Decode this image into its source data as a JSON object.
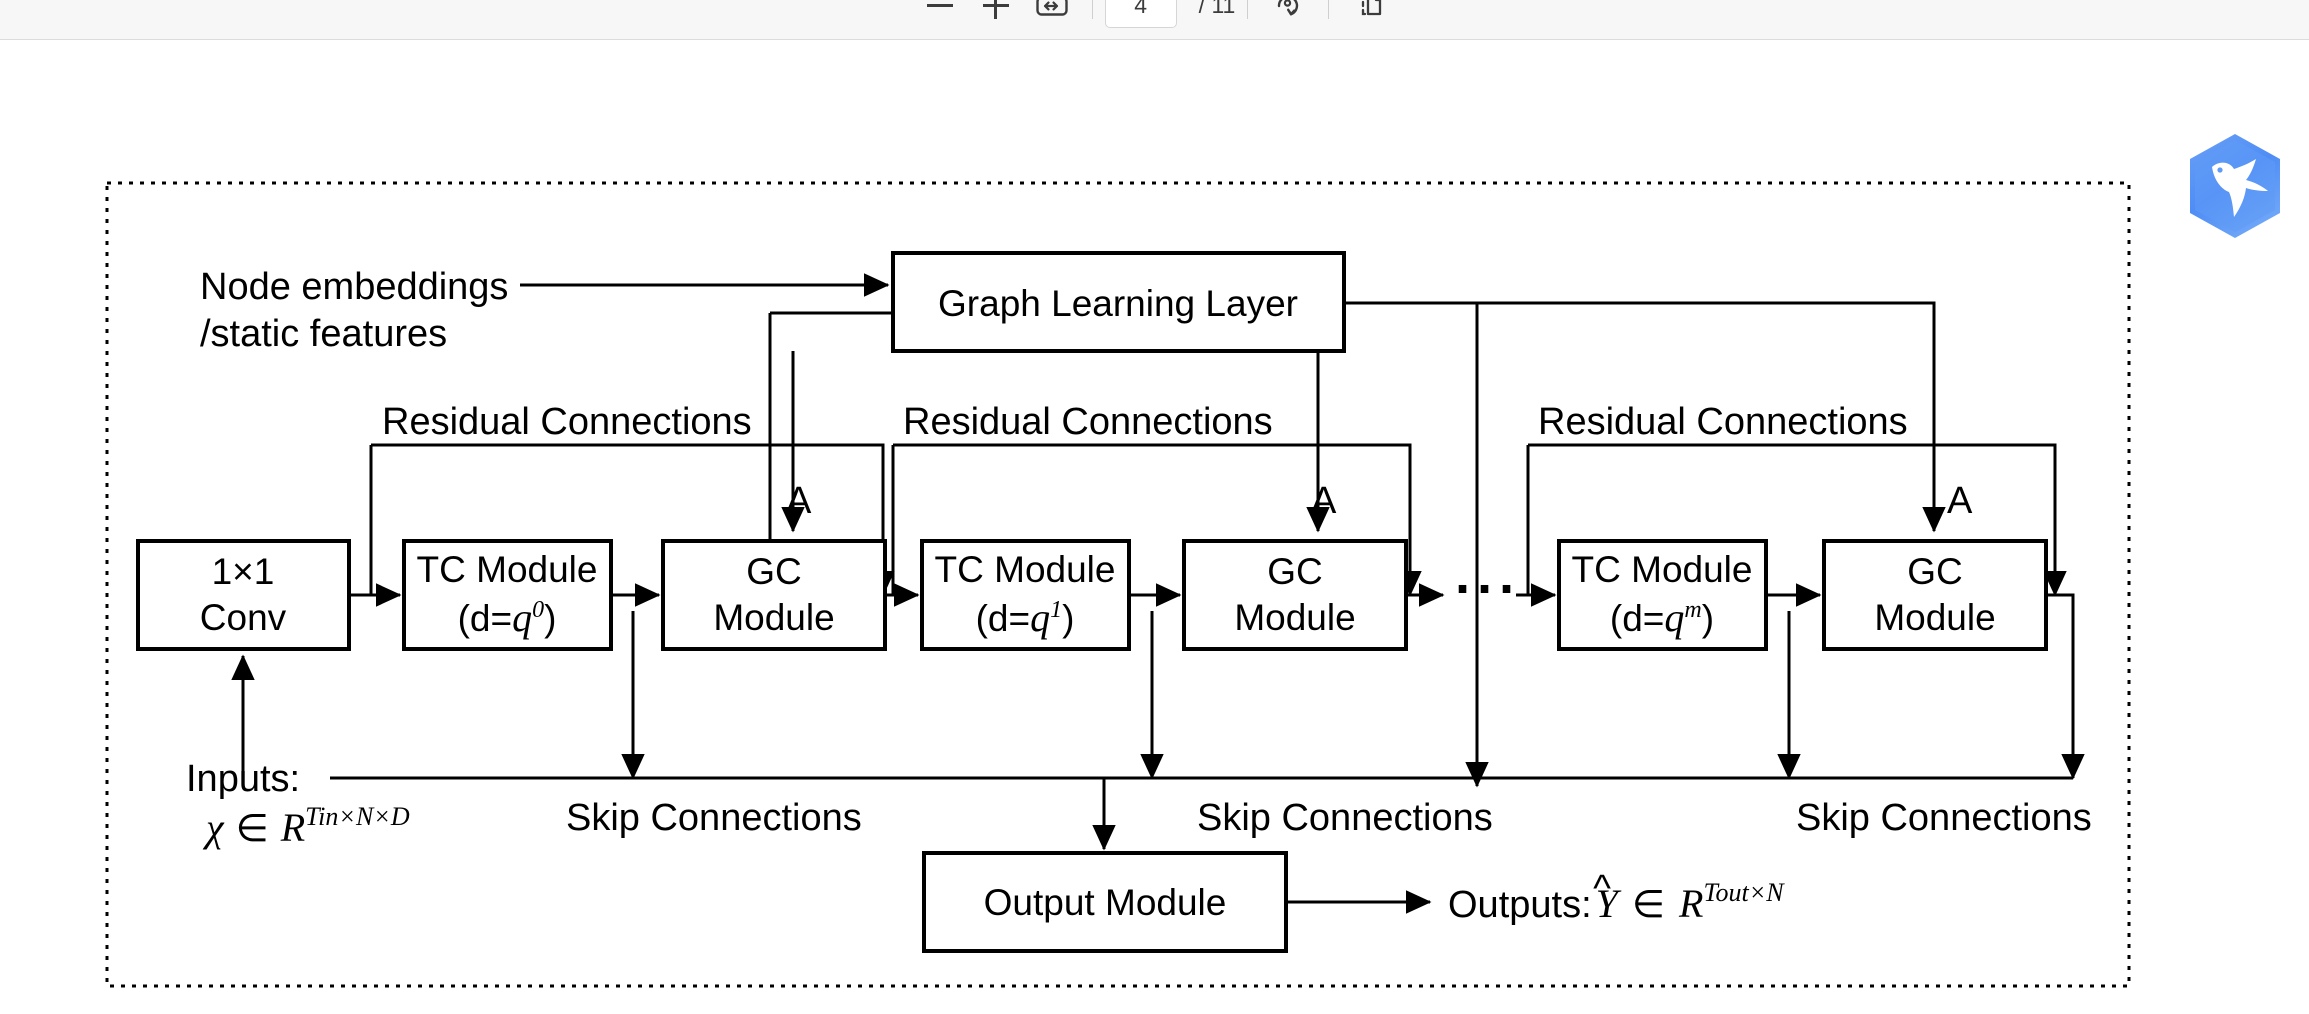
{
  "toolbar": {
    "zoom_out_label": "−",
    "zoom_out_icon": "minus-icon",
    "zoom_in_label": "+",
    "zoom_in_icon": "plus-icon",
    "fit_width_icon": "fit-width-icon",
    "current_page": "4",
    "page_total": "/ 11",
    "rotate_icon": "rotate-icon",
    "page_view_icon": "page-layout-icon"
  },
  "logo": {
    "name": "hummingbird-hexagon-logo",
    "color_outer": "#4f8df5",
    "color_inner": "#6fa3f7",
    "bird_color": "#ffffff"
  },
  "figure": {
    "border_style": "dotted",
    "inputs": {
      "label": "Inputs:",
      "tensor_var": "χ",
      "tensor_in": "∈",
      "tensor_space": "R",
      "tensor_dims": "Tin×N×D"
    },
    "node_embeddings": {
      "line1": "Node embeddings",
      "line2": "/static features"
    },
    "graph_learning_layer": "Graph Learning Layer",
    "conv_box": {
      "line1": "1×1",
      "line2": "Conv"
    },
    "adjacency_label": "A",
    "residual_label": "Residual Connections",
    "skip_label": "Skip Connections",
    "ellipsis": "···",
    "output_module": "Output Module",
    "outputs": {
      "label": "Outputs:",
      "tensor_var": "Υ",
      "tensor_hat": "^",
      "tensor_in": "∈",
      "tensor_space": "R",
      "tensor_dims": "Tout×N"
    },
    "stages": [
      {
        "tc_label": "TC Module",
        "tc_dilation_prefix": "(d=",
        "tc_dilation_base": "q",
        "tc_dilation_exp": "0",
        "tc_dilation_suffix": ")",
        "gc_line1": "GC",
        "gc_line2": "Module"
      },
      {
        "tc_label": "TC Module",
        "tc_dilation_prefix": "(d=",
        "tc_dilation_base": "q",
        "tc_dilation_exp": "1",
        "tc_dilation_suffix": ")",
        "gc_line1": "GC",
        "gc_line2": "Module"
      },
      {
        "tc_label": "TC Module",
        "tc_dilation_prefix": "(d=",
        "tc_dilation_base": "q",
        "tc_dilation_exp": "m",
        "tc_dilation_suffix": ")",
        "gc_line1": "GC",
        "gc_line2": "Module"
      }
    ]
  }
}
